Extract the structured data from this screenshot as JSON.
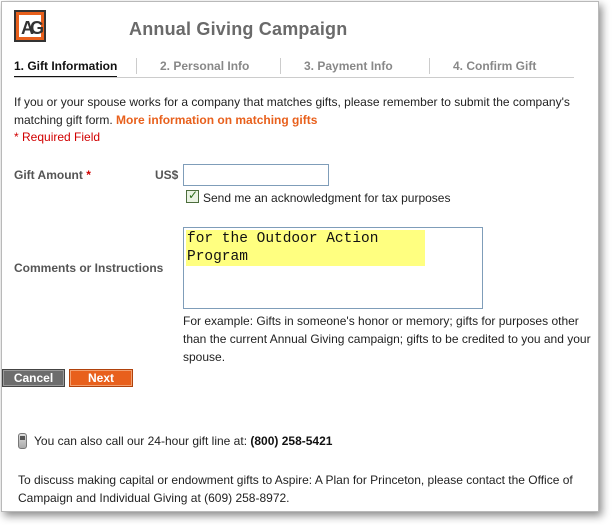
{
  "header": {
    "logo_text": "AG",
    "title": "Annual Giving Campaign"
  },
  "tabs": [
    {
      "label": "1. Gift Information",
      "active": true
    },
    {
      "label": "2. Personal Info",
      "active": false
    },
    {
      "label": "3. Payment Info",
      "active": false
    },
    {
      "label": "4. Confirm Gift",
      "active": false
    }
  ],
  "intro": {
    "text": "If you or your spouse works for a company that matches gifts, please remember to submit the company's matching gift form.",
    "link": "More information on matching gifts"
  },
  "required_note": "* Required Field",
  "gift_amount": {
    "label": "Gift Amount",
    "required_mark": "*",
    "currency": "US$",
    "value": ""
  },
  "acknowledgment": {
    "checked": true,
    "label": "Send me an acknowledgment for tax purposes"
  },
  "comments": {
    "label": "Comments or Instructions",
    "value": "for the Outdoor Action\nProgram"
  },
  "example_text": "For example: Gifts in someone's honor or memory; gifts for purposes other than the current Annual Giving campaign; gifts to be credited to you and your spouse.",
  "buttons": {
    "cancel": "Cancel",
    "next": "Next"
  },
  "phone": {
    "text": "You can also call our 24-hour gift line at:",
    "number": "(800) 258-5421"
  },
  "closing_text": "To discuss making capital or endowment gifts to Aspire: A Plan for Princeton, please contact the Office of Campaign and Individual Giving at (609) 258-8972.",
  "colors": {
    "accent": "#e8601c",
    "required": "#d10000",
    "highlight": "#ffff80"
  }
}
